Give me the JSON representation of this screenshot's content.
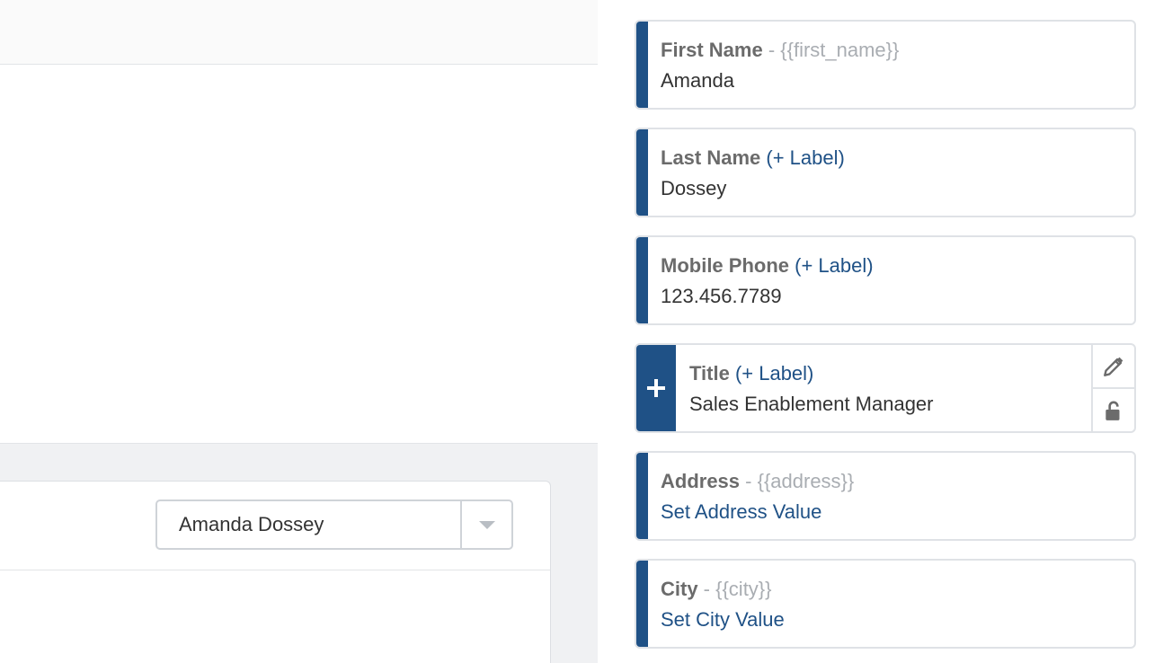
{
  "left": {
    "contact_select": {
      "value": "Amanda Dossey"
    }
  },
  "fields": [
    {
      "label": "First Name",
      "tag": " - {{first_name}}",
      "add_label": "",
      "value": "Amanda",
      "value_is_link": false
    },
    {
      "label": "Last Name",
      "tag": "",
      "add_label": " (+ Label)",
      "value": "Dossey",
      "value_is_link": false
    },
    {
      "label": "Mobile Phone",
      "tag": "",
      "add_label": " (+ Label)",
      "value": "123.456.7789",
      "value_is_link": false
    },
    {
      "label": "Title",
      "tag": "",
      "add_label": " (+ Label)",
      "value": "Sales Enablement Manager",
      "value_is_link": false,
      "expanded": true
    },
    {
      "label": "Address",
      "tag": " - {{address}}",
      "add_label": "",
      "value": "Set Address Value",
      "value_is_link": true
    },
    {
      "label": "City",
      "tag": " - {{city}}",
      "add_label": "",
      "value": "Set City Value",
      "value_is_link": true
    }
  ],
  "icons": {
    "expand": "plus-icon",
    "edit": "pencil-icon",
    "lock": "unlock-icon"
  },
  "colors": {
    "accent": "#1f5186",
    "label_gray": "#6b6b6b",
    "tag_gray": "#a9adb2",
    "border": "#dfe2e6"
  }
}
